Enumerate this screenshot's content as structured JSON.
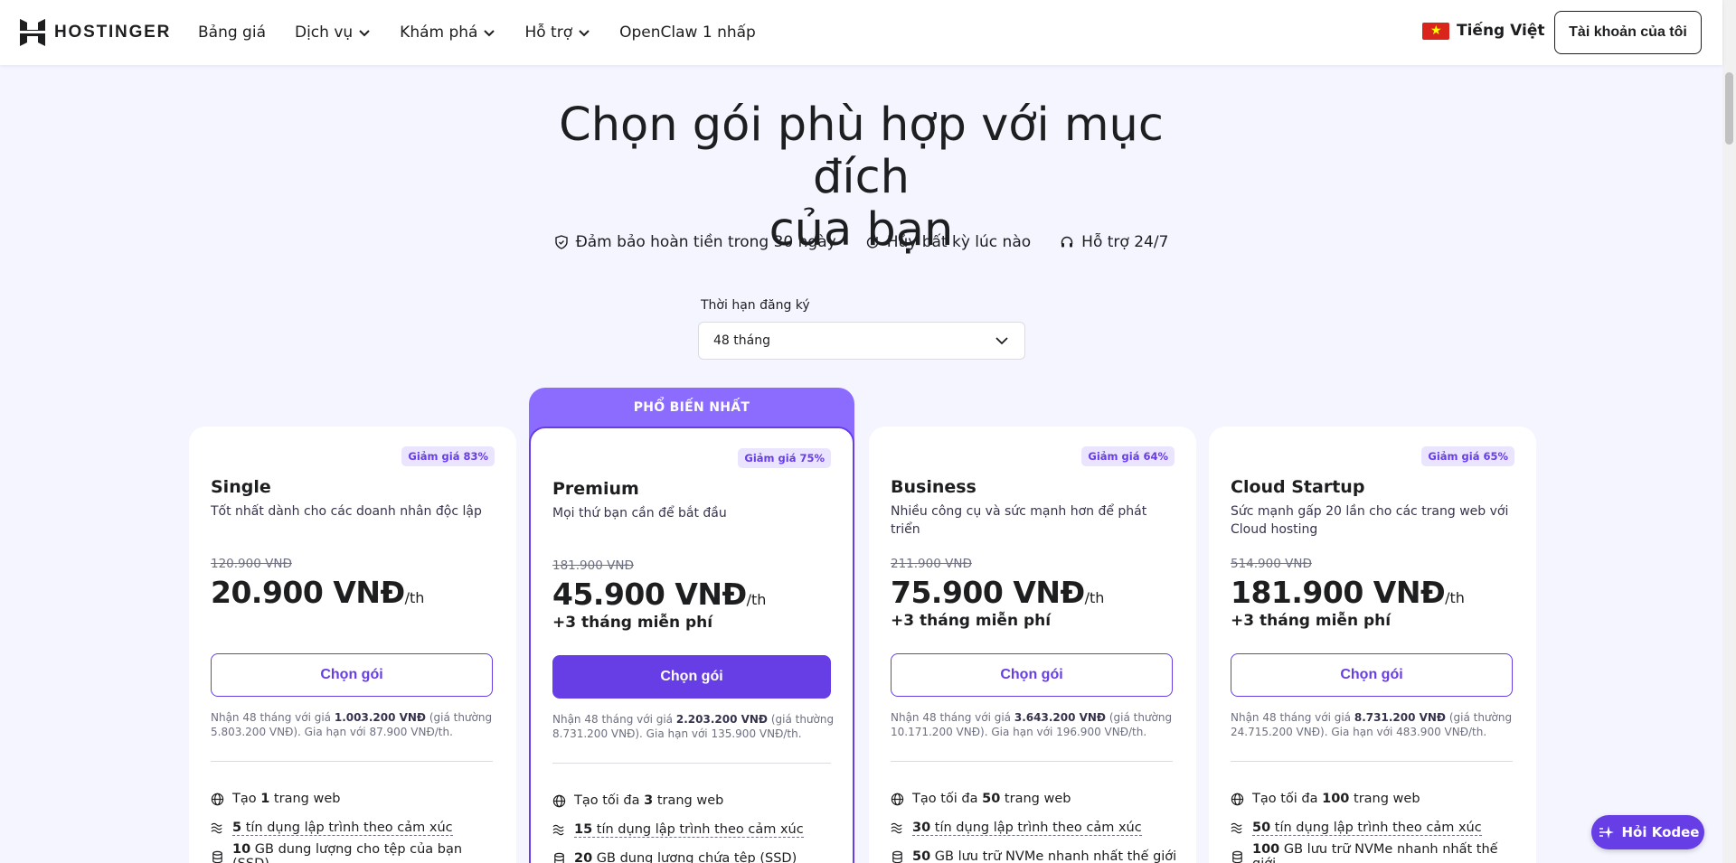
{
  "header": {
    "logo_text": "HOSTINGER",
    "nav": [
      {
        "label": "Bảng giá",
        "dropdown": false
      },
      {
        "label": "Dịch vụ",
        "dropdown": true
      },
      {
        "label": "Khám phá",
        "dropdown": true
      },
      {
        "label": "Hỗ trợ",
        "dropdown": true
      },
      {
        "label": "OpenClaw 1 nhấp",
        "dropdown": false
      }
    ],
    "language": "Tiếng Việt",
    "account_button": "Tài khoản của tôi"
  },
  "hero": {
    "title_line1": "Chọn gói phù hợp với mục đích",
    "title_line2": "của bạn",
    "guarantees": [
      {
        "icon": "shield-check-icon",
        "label": "Đảm bảo hoàn tiền trong 30 ngày"
      },
      {
        "icon": "refresh-icon",
        "label": "Hủy bất kỳ lúc nào"
      },
      {
        "icon": "headset-icon",
        "label": "Hỗ trợ 24/7"
      }
    ]
  },
  "period": {
    "label": "Thời hạn đăng ký",
    "selected": "48 tháng"
  },
  "popular_badge": "PHỔ BIẾN NHẤT",
  "plans": [
    {
      "discount": "Giảm giá 83%",
      "name": "Single",
      "desc": "Tốt nhất dành cho các doanh nhân độc lập",
      "old_price": "120.900 VNĐ",
      "price": "20.900 VNĐ",
      "per": "/th",
      "bonus": "",
      "button": "Chọn gói",
      "renew_pre": "Nhận 48 tháng với giá ",
      "renew_total": "1.003.200 VNĐ",
      "renew_post": " (giá thường 5.803.200 VNĐ). Gia hạn với 87.900 VNĐ/th.",
      "features": [
        {
          "icon": "globe-icon",
          "bold": "1",
          "pre": "Tạo ",
          "post": " trang web",
          "dashed": false
        },
        {
          "icon": "ai-credits-icon",
          "bold": "5",
          "pre": "",
          "post": " tín dụng lập trình theo cảm xúc",
          "dashed": true
        },
        {
          "icon": "storage-icon",
          "bold": "10",
          "pre": "",
          "post": " GB dung lượng cho tệp của bạn (SSD)",
          "dashed": false
        }
      ]
    },
    {
      "discount": "Giảm giá 75%",
      "name": "Premium",
      "desc": "Mọi thứ bạn cần để bắt đầu",
      "old_price": "181.900 VNĐ",
      "price": "45.900 VNĐ",
      "per": "/th",
      "bonus": "+3 tháng miễn phí",
      "button": "Chọn gói",
      "renew_pre": "Nhận 48 tháng với giá ",
      "renew_total": "2.203.200 VNĐ",
      "renew_post": " (giá thường 8.731.200 VNĐ). Gia hạn với 135.900 VNĐ/th.",
      "features": [
        {
          "icon": "globe-icon",
          "bold": "3",
          "pre": "Tạo tối đa ",
          "post": " trang web",
          "dashed": false
        },
        {
          "icon": "ai-credits-icon",
          "bold": "15",
          "pre": "",
          "post": " tín dụng lập trình theo cảm xúc",
          "dashed": true
        },
        {
          "icon": "storage-icon",
          "bold": "20",
          "pre": "",
          "post": " GB dung lượng chứa tệp (SSD)",
          "dashed": false
        }
      ]
    },
    {
      "discount": "Giảm giá 64%",
      "name": "Business",
      "desc": "Nhiều công cụ và sức mạnh hơn để phát triển",
      "old_price": "211.900 VNĐ",
      "price": "75.900 VNĐ",
      "per": "/th",
      "bonus": "+3 tháng miễn phí",
      "button": "Chọn gói",
      "renew_pre": "Nhận 48 tháng với giá ",
      "renew_total": "3.643.200 VNĐ",
      "renew_post": " (giá thường 10.171.200 VNĐ). Gia hạn với 196.900 VNĐ/th.",
      "features": [
        {
          "icon": "globe-icon",
          "bold": "50",
          "pre": "Tạo tối đa ",
          "post": " trang web",
          "dashed": false
        },
        {
          "icon": "ai-credits-icon",
          "bold": "30",
          "pre": "",
          "post": " tín dụng lập trình theo cảm xúc",
          "dashed": true
        },
        {
          "icon": "storage-icon",
          "bold": "50",
          "pre": "",
          "post": " GB lưu trữ NVMe nhanh nhất thế giới",
          "dashed": false
        }
      ]
    },
    {
      "discount": "Giảm giá 65%",
      "name": "Cloud Startup",
      "desc": "Sức mạnh gấp 20 lần cho các trang web với Cloud hosting",
      "old_price": "514.900 VNĐ",
      "price": "181.900 VNĐ",
      "per": "/th",
      "bonus": "+3 tháng miễn phí",
      "button": "Chọn gói",
      "renew_pre": "Nhận 48 tháng với giá ",
      "renew_total": "8.731.200 VNĐ",
      "renew_post": " (giá thường 24.715.200 VNĐ). Gia hạn với 483.900 VNĐ/th.",
      "features": [
        {
          "icon": "globe-icon",
          "bold": "100",
          "pre": "Tạo tối đa ",
          "post": " trang web",
          "dashed": false
        },
        {
          "icon": "ai-credits-icon",
          "bold": "50",
          "pre": "",
          "post": " tín dụng lập trình theo cảm xúc",
          "dashed": true
        },
        {
          "icon": "storage-icon",
          "bold": "100",
          "pre": "",
          "post": " GB lưu trữ NVMe nhanh nhất thế giới",
          "dashed": false
        }
      ]
    }
  ],
  "chat_button": "Hỏi Kodee",
  "colors": {
    "accent": "#673de6",
    "popular_banner": "#8c6cff",
    "discount_bg": "#ebe4ff",
    "background": "#f4f5ff"
  }
}
